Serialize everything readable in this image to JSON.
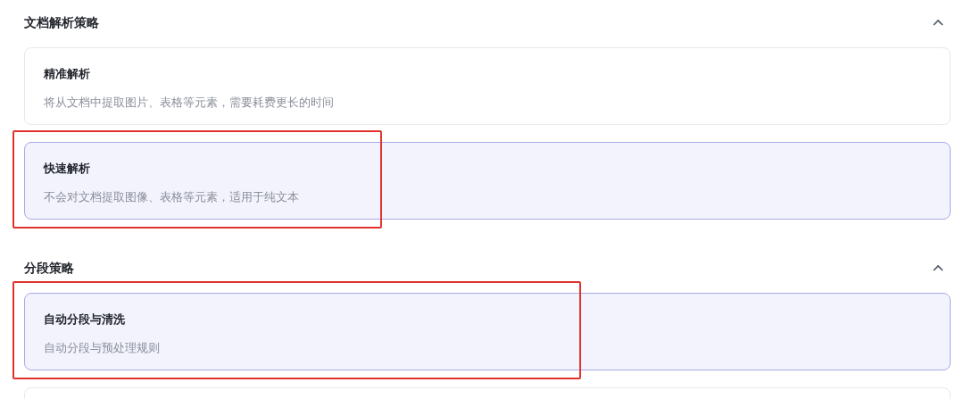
{
  "sections": [
    {
      "title": "文档解析策略",
      "expanded": true,
      "options": [
        {
          "title": "精准解析",
          "description": "将从文档中提取图片、表格等元素，需要耗费更长的时间",
          "selected": false,
          "highlighted": false
        },
        {
          "title": "快速解析",
          "description": "不会对文档提取图像、表格等元素，适用于纯文本",
          "selected": true,
          "highlighted": true
        }
      ]
    },
    {
      "title": "分段策略",
      "expanded": true,
      "options": [
        {
          "title": "自动分段与清洗",
          "description": "自动分段与预处理规则",
          "selected": true,
          "highlighted": true
        },
        {
          "selected": false,
          "highlighted": false
        }
      ]
    }
  ]
}
